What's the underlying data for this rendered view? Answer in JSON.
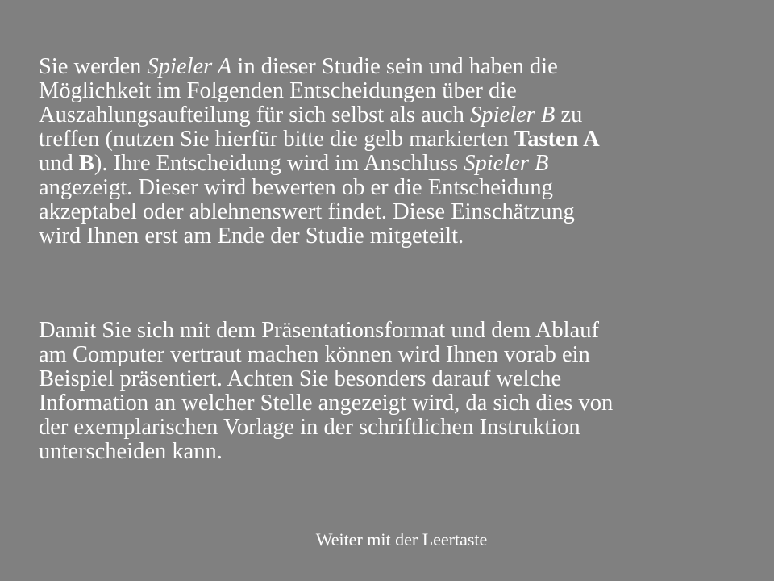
{
  "instructions": {
    "paragraph_1": {
      "line_1": {
        "before": "Sie werden ",
        "role_a": "Spieler A",
        "after": " in dieser Studie sein und haben die"
      },
      "line_2": "Möglichkeit im Folgenden Entscheidungen über die",
      "line_3": {
        "before": "Auszahlungsaufteilung für sich selbst als auch ",
        "role_b": "Spieler B",
        "after": " zu"
      },
      "line_4": {
        "before": "treffen (nutzen Sie hierfür bitte die gelb markierten ",
        "keys_label": "Tasten A"
      },
      "line_5": {
        "before": "und ",
        "key_b": "B",
        "middle": "). Ihre Entscheidung wird im Anschluss ",
        "role_b": "Spieler B"
      },
      "line_6": "angezeigt. Dieser wird bewerten ob er die Entscheidung",
      "line_7": "akzeptabel oder ablehnenswert findet. Diese Einschätzung",
      "line_8": "wird Ihnen erst am Ende der Studie mitgeteilt."
    },
    "paragraph_2": {
      "line_1": "Damit Sie sich mit dem Präsentationsformat und dem Ablauf",
      "line_2": "am Computer vertraut machen können wird Ihnen vorab ein",
      "line_3": "Beispiel präsentiert. Achten Sie besonders darauf welche",
      "line_4": "Information an welcher Stelle angezeigt wird, da sich dies von",
      "line_5": "der exemplarischen Vorlage in der schriftlichen Instruktion",
      "line_6": "unterscheiden kann."
    }
  },
  "continue_hint": "Weiter mit der Leertaste",
  "colors": {
    "background": "#808080",
    "text": "#ffffff"
  }
}
